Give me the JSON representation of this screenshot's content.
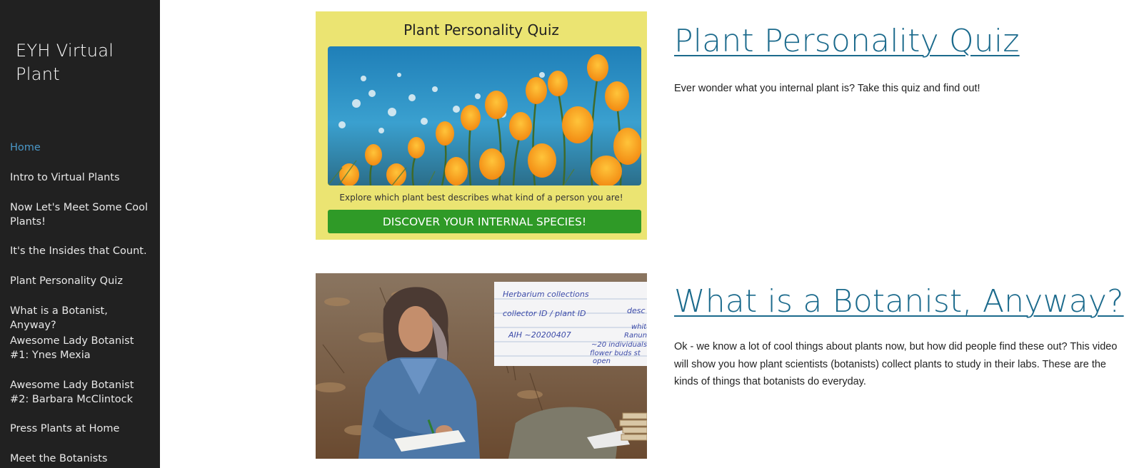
{
  "site": {
    "title": "EYH Virtual Plant"
  },
  "nav": {
    "items": [
      {
        "label": "Home",
        "active": true
      },
      {
        "label": "Intro to Virtual Plants",
        "active": false
      },
      {
        "label": "Now Let's Meet Some Cool Plants!",
        "active": false
      },
      {
        "label": "It's the Insides that Count.",
        "active": false
      },
      {
        "label": "Plant Personality Quiz",
        "active": false
      },
      {
        "label": "What is a Botanist, Anyway?",
        "active": false
      },
      {
        "label": "Awesome Lady Botanist #1: Ynes Mexia",
        "active": false
      },
      {
        "label": "Awesome Lady Botanist #2: Barbara McClintock",
        "active": false
      },
      {
        "label": "Press Plants at Home",
        "active": false
      },
      {
        "label": "Meet the Botanists",
        "active": false
      }
    ]
  },
  "quiz_card": {
    "title": "Plant Personality Quiz",
    "caption": "Explore which plant best describes what kind of a person you are!",
    "button_label": "DISCOVER YOUR INTERNAL SPECIES!"
  },
  "sections": [
    {
      "heading": "Plant Personality Quiz",
      "text": "Ever wonder what you internal plant is? Take this quiz and find out!"
    },
    {
      "heading": "What is a Botanist, Anyway?",
      "text": "Ok - we know a lot of cool things about plants now, but how did people find these out? This video will show you how plant scientists (botanists) collect plants to study in their labs. These are the kinds of things that botanists do everyday."
    }
  ],
  "herbarium_note": {
    "lines": [
      "Herbarium collections",
      "collector ID / plant ID",
      "desc",
      "AIH  ~20200407",
      "white flo",
      "Ranuncula",
      "~20 individuals",
      "flower buds st",
      "open"
    ]
  },
  "colors": {
    "sidebar_bg": "#212121",
    "nav_active": "#4a98c8",
    "link": "#1b6a8c",
    "quiz_card_bg": "#ebe472",
    "quiz_button": "#2f9a27"
  }
}
